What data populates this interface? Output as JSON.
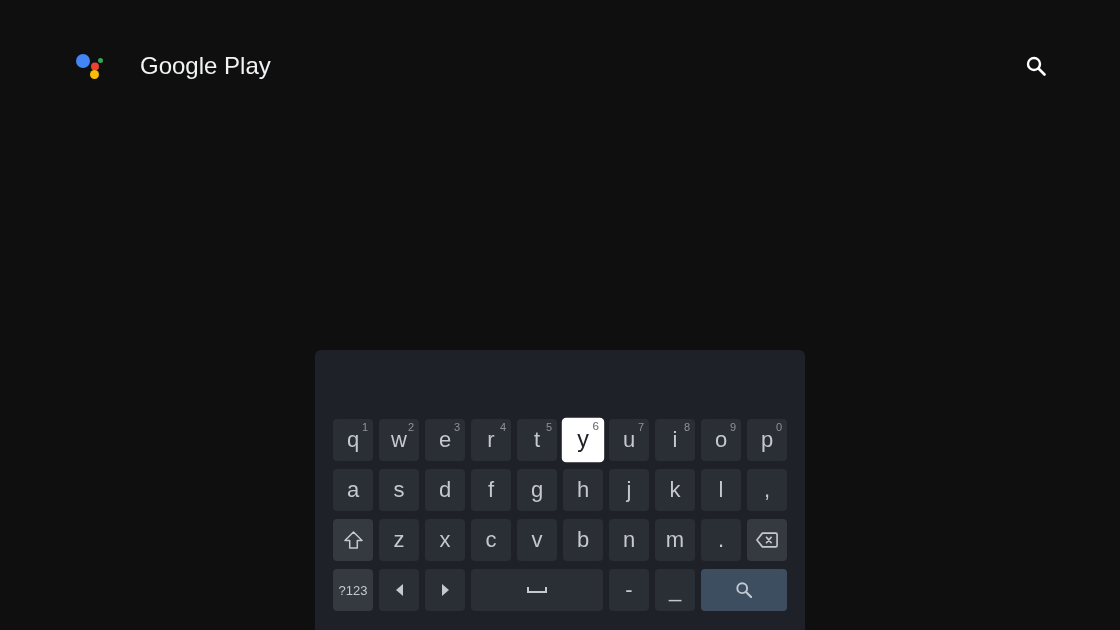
{
  "header": {
    "title": "Google Play"
  },
  "keyboard": {
    "letter_rows": [
      [
        {
          "kind": "char",
          "label": "q",
          "hint": "1",
          "selected": false
        },
        {
          "kind": "char",
          "label": "w",
          "hint": "2",
          "selected": false
        },
        {
          "kind": "char",
          "label": "e",
          "hint": "3",
          "selected": false
        },
        {
          "kind": "char",
          "label": "r",
          "hint": "4",
          "selected": false
        },
        {
          "kind": "char",
          "label": "t",
          "hint": "5",
          "selected": false
        },
        {
          "kind": "char",
          "label": "y",
          "hint": "6",
          "selected": true
        },
        {
          "kind": "char",
          "label": "u",
          "hint": "7",
          "selected": false
        },
        {
          "kind": "char",
          "label": "i",
          "hint": "8",
          "selected": false
        },
        {
          "kind": "char",
          "label": "o",
          "hint": "9",
          "selected": false
        },
        {
          "kind": "char",
          "label": "p",
          "hint": "0",
          "selected": false
        }
      ],
      [
        {
          "kind": "char",
          "label": "a",
          "selected": false
        },
        {
          "kind": "char",
          "label": "s",
          "selected": false
        },
        {
          "kind": "char",
          "label": "d",
          "selected": false
        },
        {
          "kind": "char",
          "label": "f",
          "selected": false
        },
        {
          "kind": "char",
          "label": "g",
          "selected": false
        },
        {
          "kind": "char",
          "label": "h",
          "selected": false
        },
        {
          "kind": "char",
          "label": "j",
          "selected": false
        },
        {
          "kind": "char",
          "label": "k",
          "selected": false
        },
        {
          "kind": "char",
          "label": "l",
          "selected": false
        },
        {
          "kind": "char",
          "label": ",",
          "selected": false
        }
      ],
      [
        {
          "kind": "shift",
          "selected": false
        },
        {
          "kind": "char",
          "label": "z",
          "selected": false
        },
        {
          "kind": "char",
          "label": "x",
          "selected": false
        },
        {
          "kind": "char",
          "label": "c",
          "selected": false
        },
        {
          "kind": "char",
          "label": "v",
          "selected": false
        },
        {
          "kind": "char",
          "label": "b",
          "selected": false
        },
        {
          "kind": "char",
          "label": "n",
          "selected": false
        },
        {
          "kind": "char",
          "label": "m",
          "selected": false
        },
        {
          "kind": "char",
          "label": ".",
          "selected": false
        },
        {
          "kind": "backspace",
          "selected": false
        }
      ]
    ],
    "bottom_row": [
      {
        "kind": "mode",
        "label": "?123",
        "selected": false
      },
      {
        "kind": "left",
        "selected": false
      },
      {
        "kind": "right",
        "selected": false
      },
      {
        "kind": "space",
        "selected": false
      },
      {
        "kind": "char",
        "label": "-",
        "selected": false
      },
      {
        "kind": "char",
        "label": "_",
        "selected": false
      },
      {
        "kind": "search",
        "selected": false
      }
    ]
  }
}
